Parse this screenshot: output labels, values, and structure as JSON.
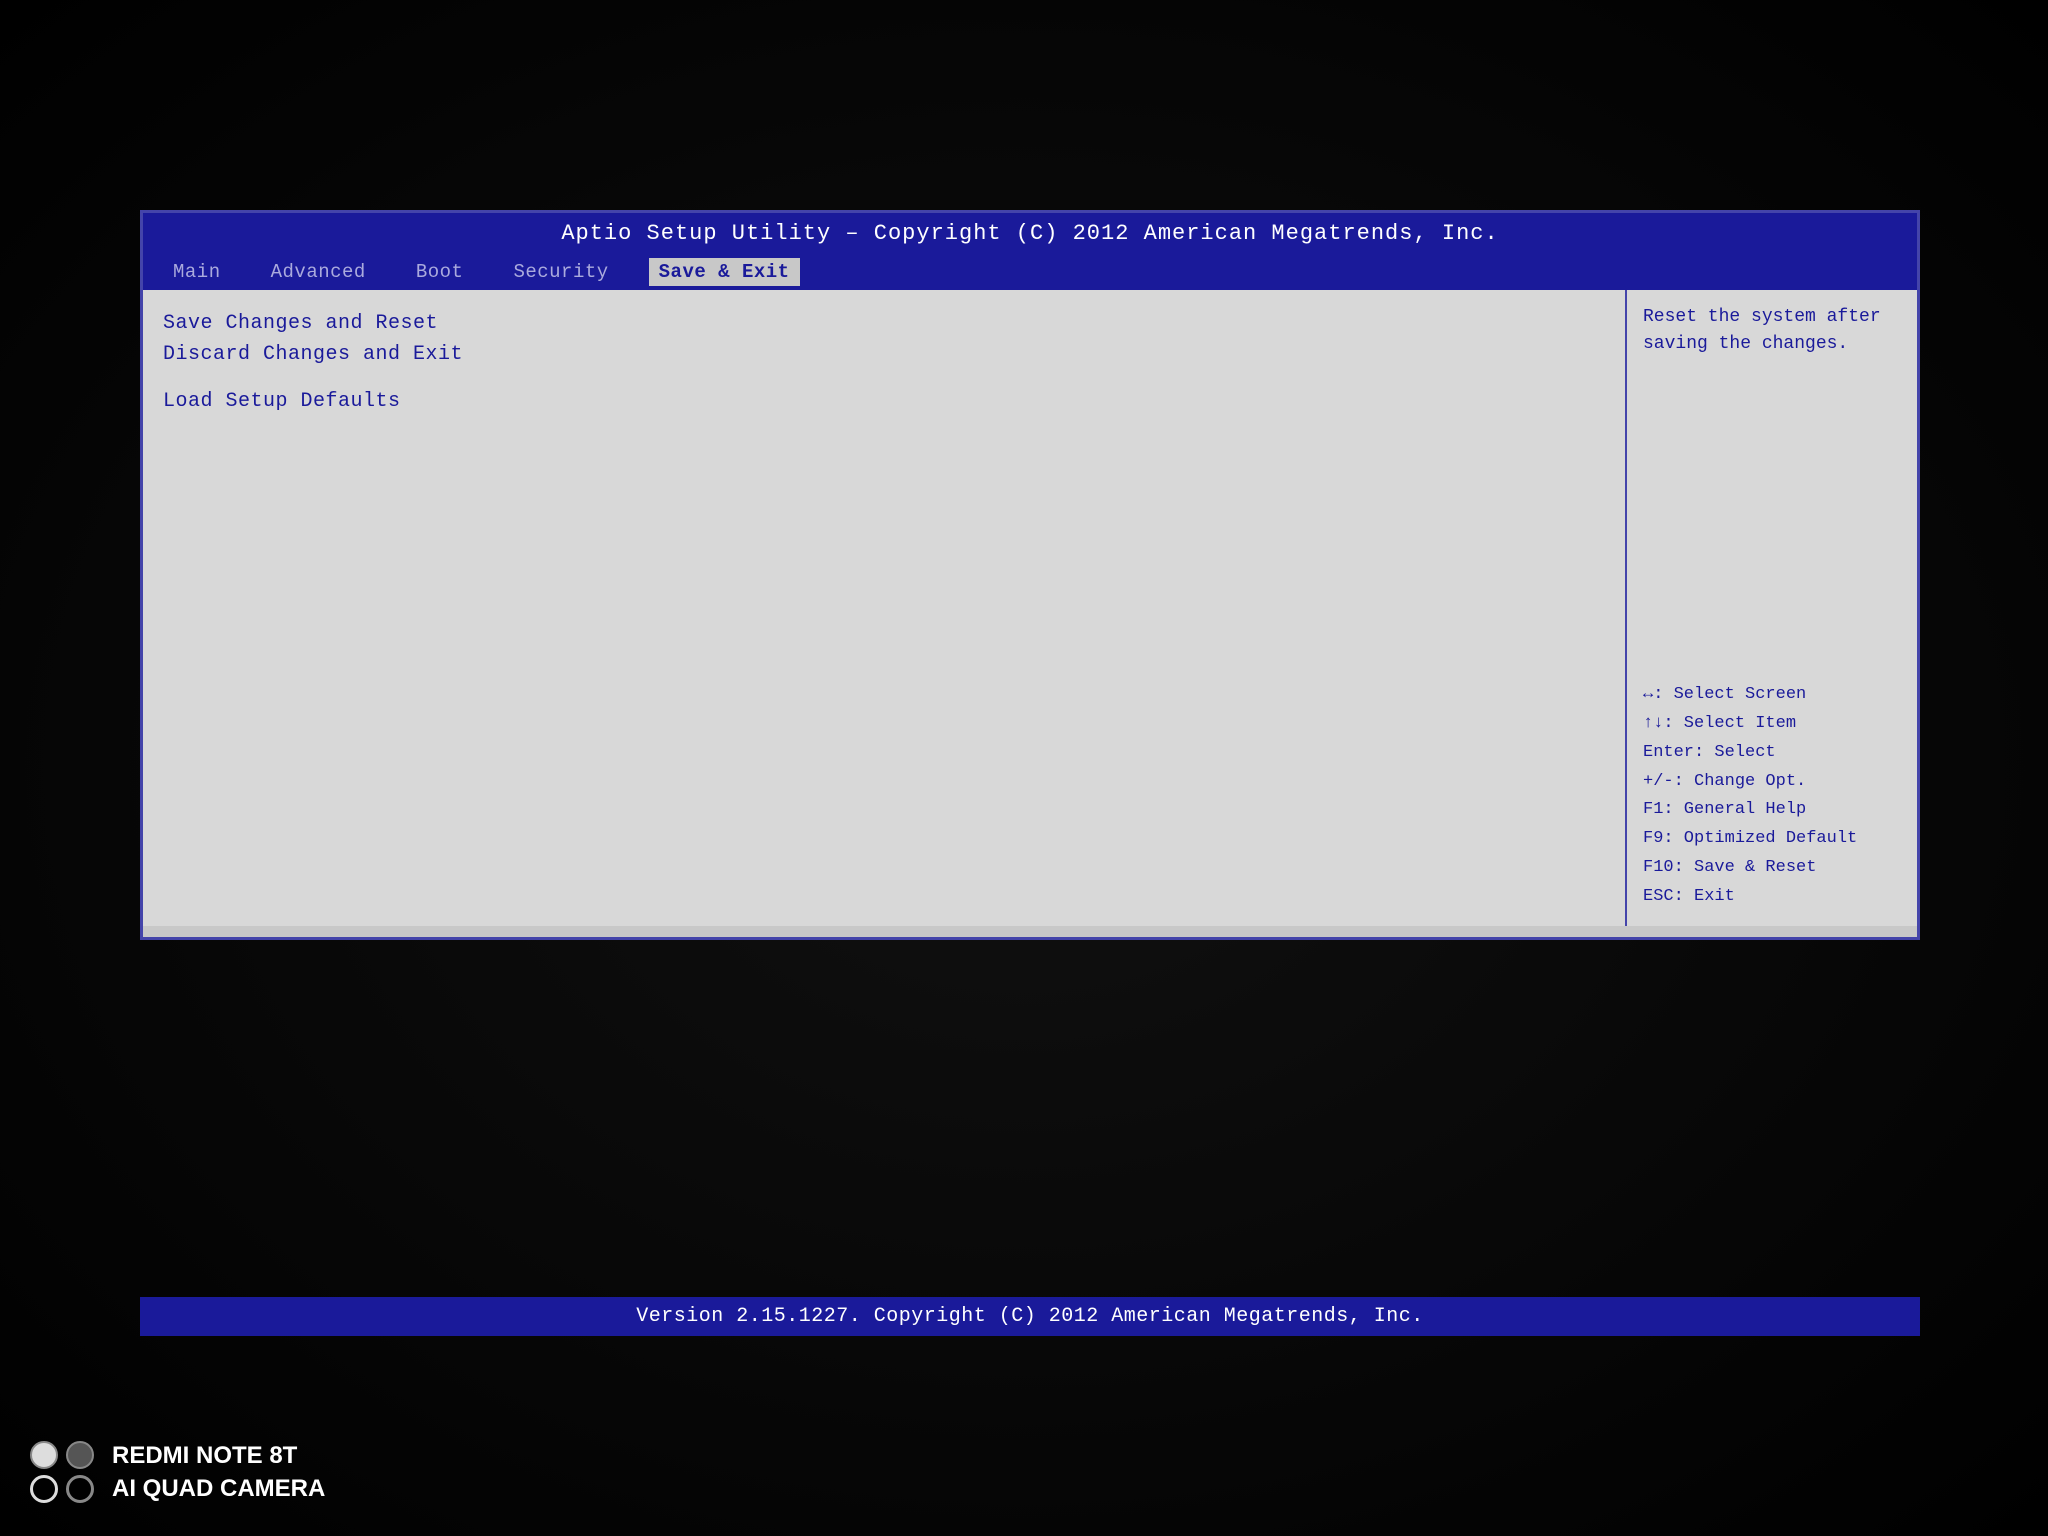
{
  "bios": {
    "title": "Aptio Setup Utility – Copyright (C) 2012 American Megatrends, Inc.",
    "footer": "Version 2.15.1227. Copyright (C) 2012 American Megatrends, Inc.",
    "nav": {
      "tabs": [
        {
          "label": "Main",
          "active": false
        },
        {
          "label": "Advanced",
          "active": false
        },
        {
          "label": "Boot",
          "active": false
        },
        {
          "label": "Security",
          "active": false
        },
        {
          "label": "Save & Exit",
          "active": true
        }
      ]
    },
    "menu": {
      "items": [
        {
          "label": "Save Changes and Reset",
          "selected": true
        },
        {
          "label": "Discard Changes and Exit",
          "selected": false
        },
        {
          "label": "Load Setup Defaults",
          "selected": false
        }
      ]
    },
    "help": {
      "description": "Reset the system after saving the changes.",
      "keys": [
        "↔: Select Screen",
        "↑↓: Select Item",
        "Enter: Select",
        "+/-: Change Opt.",
        "F1: General Help",
        "F9: Optimized Default",
        "F10: Save & Reset",
        "ESC: Exit"
      ]
    }
  },
  "watermark": {
    "line1": "REDMI NOTE 8T",
    "line2": "AI QUAD CAMERA"
  }
}
